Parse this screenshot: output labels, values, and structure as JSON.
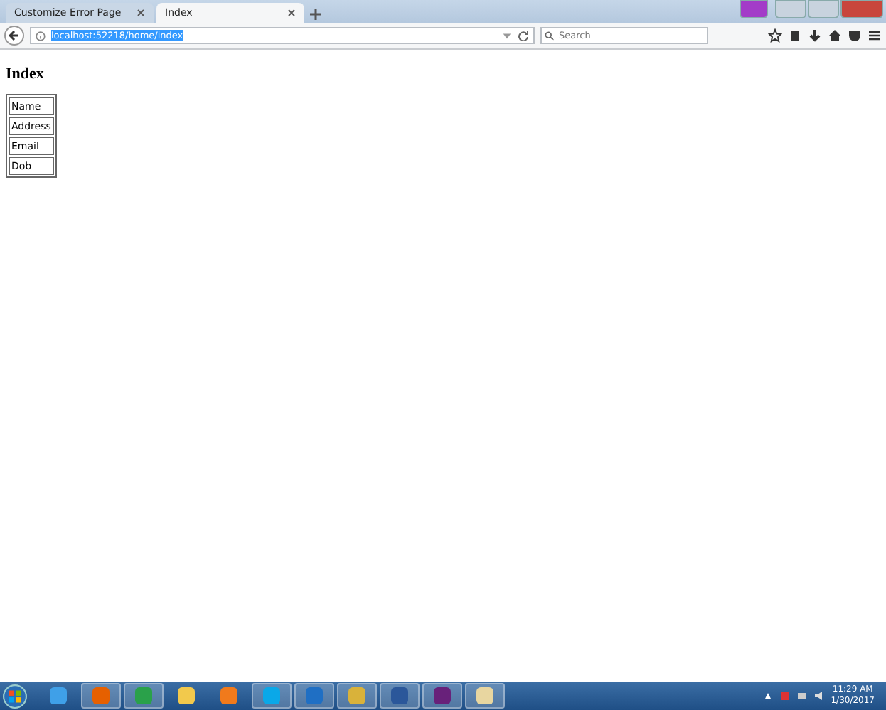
{
  "tabs": [
    {
      "label": "Customize Error Page",
      "selected": false
    },
    {
      "label": "Index",
      "selected": true
    }
  ],
  "address_bar": {
    "url": "localhost:52218/home/index"
  },
  "search": {
    "placeholder": "Search"
  },
  "page": {
    "heading": "Index",
    "table": {
      "rows": [
        "Name",
        "Address",
        "Email",
        "Dob"
      ]
    }
  },
  "taskbar": {
    "time": "11:29 AM",
    "date": "1/30/2017"
  }
}
